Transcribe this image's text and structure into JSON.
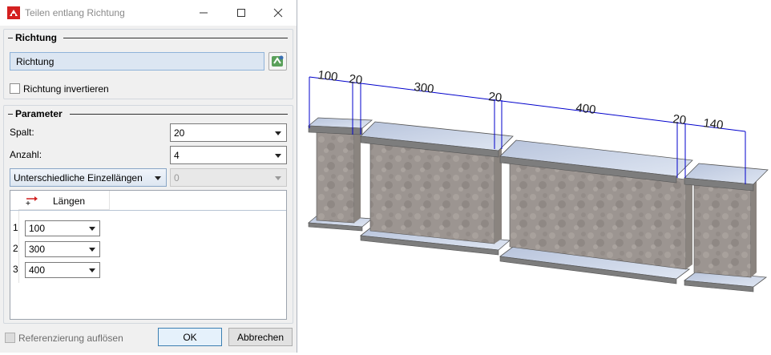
{
  "dialog": {
    "title": "Teilen entlang Richtung",
    "groups": {
      "richtung": {
        "title": "Richtung",
        "field_value": "Richtung",
        "invert_label": "Richtung invertieren",
        "invert_checked": false
      },
      "parameter": {
        "title": "Parameter",
        "spalt_label": "Spalt:",
        "spalt_value": "20",
        "anzahl_label": "Anzahl:",
        "anzahl_value": "4",
        "mode_value": "Unterschiedliche Einzellängen",
        "mode_side_value": "0"
      }
    },
    "table": {
      "column_header": "Längen",
      "rows": [
        {
          "index": "1",
          "value": "100"
        },
        {
          "index": "2",
          "value": "300"
        },
        {
          "index": "3",
          "value": "400"
        }
      ]
    },
    "footer": {
      "referenz_label": "Referenzierung auflösen",
      "ok_label": "OK",
      "cancel_label": "Abbrechen"
    }
  },
  "viewport": {
    "dimensions": [
      "100",
      "20",
      "300",
      "20",
      "400",
      "20",
      "140"
    ],
    "dimension_color": "#0000cc"
  },
  "colors": {
    "app_icon": "#d42020",
    "dialog_bg": "#f0f0f0",
    "field_highlight": "#dce6f2",
    "flange_top": "#c9d3e6"
  },
  "icons": {
    "app": "app-logo-icon",
    "minimize": "minimize-icon",
    "maximize": "maximize-icon",
    "close": "close-icon",
    "pick": "pick-direction-icon",
    "add_column": "add-length-icon"
  }
}
